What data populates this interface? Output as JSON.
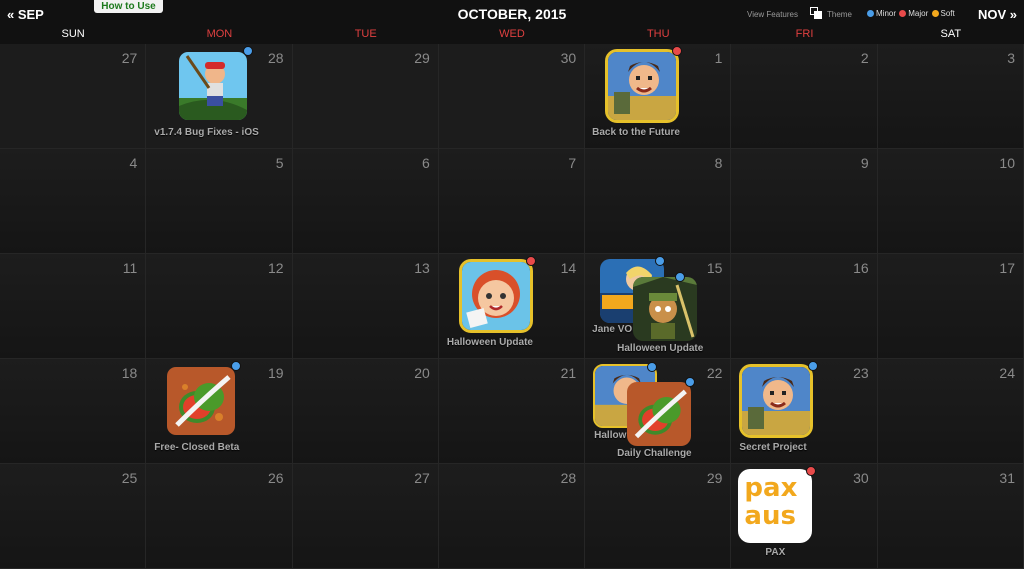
{
  "header": {
    "prev_label": "« SEP",
    "next_label": "NOV »",
    "how_to_label": "How to Use",
    "month_title": "OCTOBER, 2015",
    "view_features_label": "View Features",
    "theme_label": "Theme",
    "legend": [
      {
        "label": "Minor",
        "color": "#4a9de8"
      },
      {
        "label": "Major",
        "color": "#e84a4a"
      },
      {
        "label": "Soft",
        "color": "#f2a81d"
      }
    ]
  },
  "weekdays": [
    {
      "label": "SUN",
      "highlight": false
    },
    {
      "label": "MON",
      "highlight": true
    },
    {
      "label": "TUE",
      "highlight": true
    },
    {
      "label": "WED",
      "highlight": true
    },
    {
      "label": "THU",
      "highlight": true
    },
    {
      "label": "FRI",
      "highlight": true
    },
    {
      "label": "SAT",
      "highlight": false
    }
  ],
  "days": [
    "27",
    "28",
    "29",
    "30",
    "1",
    "2",
    "3",
    "4",
    "5",
    "6",
    "7",
    "8",
    "9",
    "10",
    "11",
    "12",
    "13",
    "14",
    "15",
    "16",
    "17",
    "18",
    "19",
    "20",
    "21",
    "22",
    "23",
    "24",
    "25",
    "26",
    "27",
    "28",
    "29",
    "30",
    "31"
  ],
  "events": {
    "e1": {
      "label": "v1.7.4 Bug Fixes - iOS",
      "icon": "pitfall-app-icon",
      "marker": "minor"
    },
    "e2": {
      "label": "Back to the Future",
      "icon": "jetpack-joyride-app-icon",
      "marker": "major"
    },
    "e3": {
      "label": "Halloween Update",
      "icon": "girl-character-app-icon",
      "marker": "major"
    },
    "e4": {
      "label": "Jane VO",
      "icon": "jane-vo-app-icon",
      "marker": "minor"
    },
    "e5": {
      "label": "Halloween Update",
      "icon": "jungle-character-app-icon",
      "marker": "minor"
    },
    "e6": {
      "label": "Free- Closed Beta",
      "icon": "fruit-ninja-app-icon",
      "marker": "minor"
    },
    "e7": {
      "label": "Hallow",
      "icon": "jetpack-joyride-app-icon",
      "marker": "minor"
    },
    "e8": {
      "label": "Daily Challenge",
      "icon": "fruit-ninja-app-icon",
      "marker": "minor"
    },
    "e9": {
      "label": "Secret Project",
      "icon": "jetpack-joyride-app-icon",
      "marker": "minor"
    },
    "e10": {
      "label": "PAX",
      "icon": "pax-aus-logo-icon",
      "marker": "major",
      "logo_text_top": "pax",
      "logo_text_bottom": "aus"
    }
  },
  "colors": {
    "minor": "#4a9de8",
    "major": "#e84a4a",
    "soft": "#f2a81d",
    "highlight_day": "#e04040"
  }
}
